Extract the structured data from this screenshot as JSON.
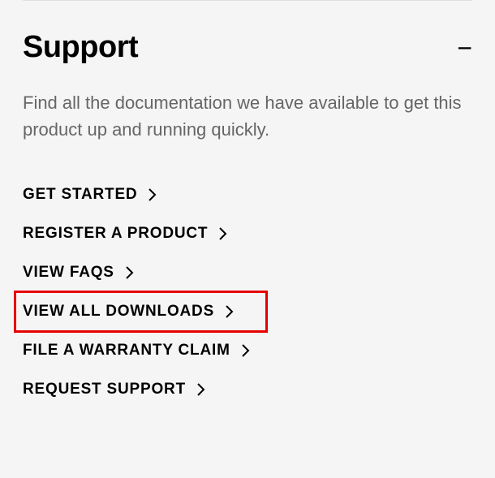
{
  "section": {
    "title": "Support",
    "description": "Find all the documentation we have available to get this product up and running quickly.",
    "links": [
      {
        "label": "GET STARTED"
      },
      {
        "label": "REGISTER A PRODUCT"
      },
      {
        "label": "VIEW FAQS"
      },
      {
        "label": "VIEW ALL DOWNLOADS"
      },
      {
        "label": "FILE A WARRANTY CLAIM"
      },
      {
        "label": "REQUEST SUPPORT"
      }
    ],
    "highlightedIndex": 3
  }
}
